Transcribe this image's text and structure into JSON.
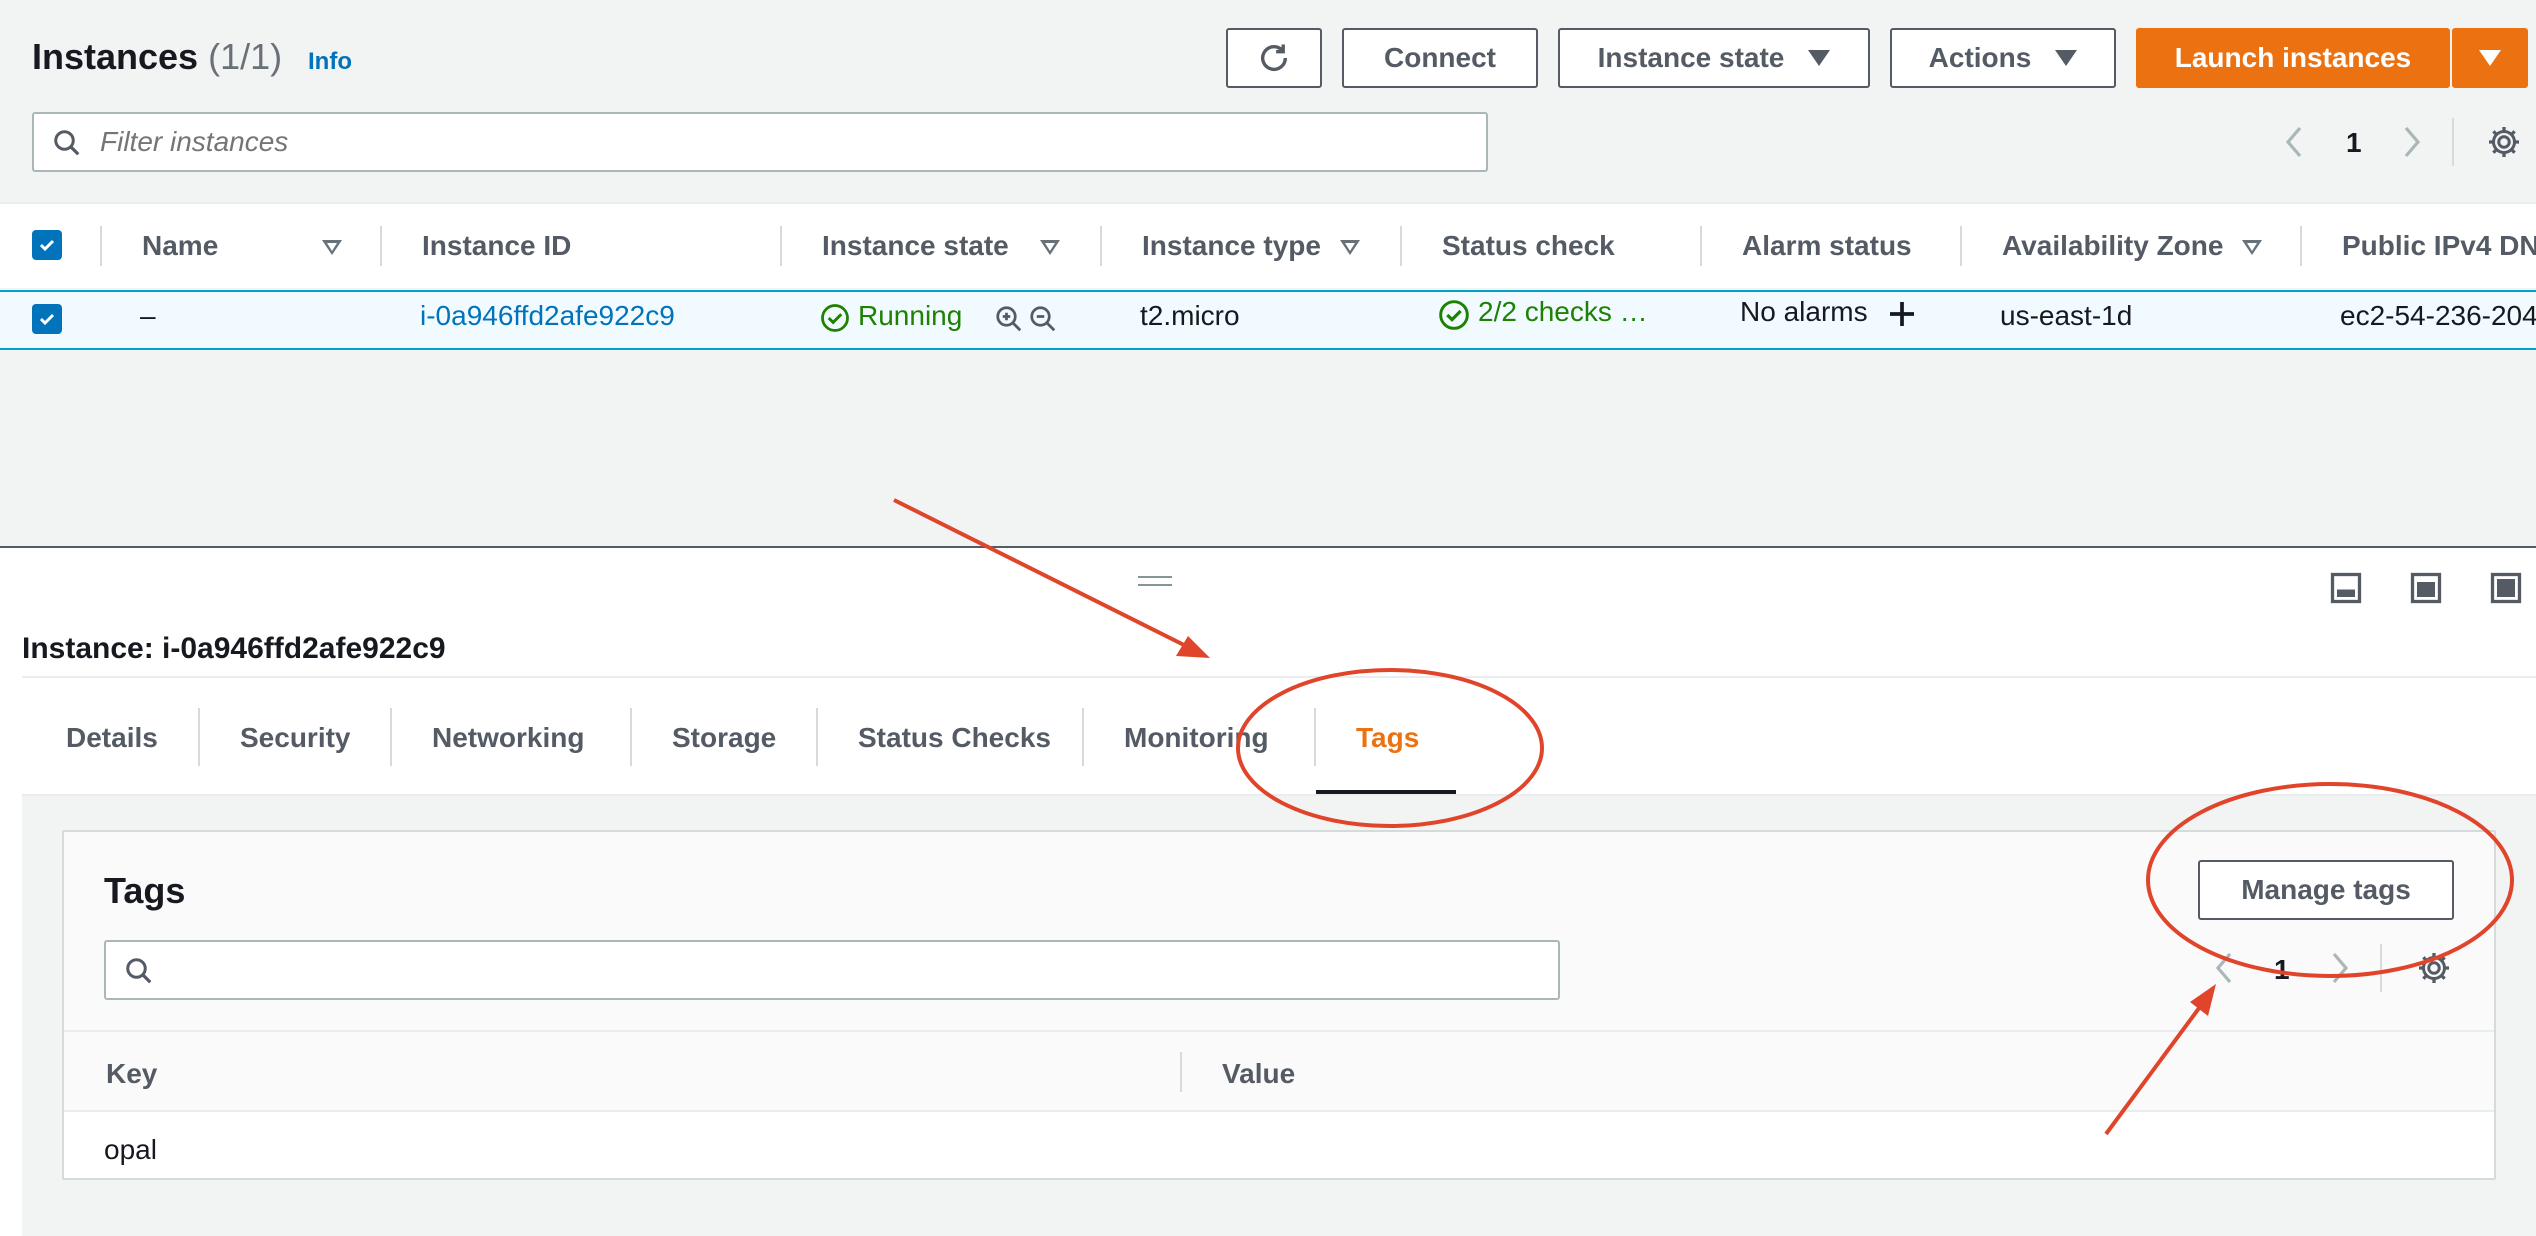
{
  "header": {
    "title": "Instances",
    "count": "(1/1)",
    "info": "Info"
  },
  "toolbar": {
    "connect": "Connect",
    "instance_state": "Instance state",
    "actions": "Actions",
    "launch": "Launch instances"
  },
  "filter": {
    "placeholder": "Filter instances"
  },
  "pagination": {
    "page": "1"
  },
  "table": {
    "columns": [
      "Name",
      "Instance ID",
      "Instance state",
      "Instance type",
      "Status check",
      "Alarm status",
      "Availability Zone",
      "Public IPv4 DN"
    ],
    "row": {
      "name": "–",
      "instance_id": "i-0a946ffd2afe922c9",
      "state": "Running",
      "type": "t2.micro",
      "status_check": "2/2 checks …",
      "alarm": "No alarms",
      "az": "us-east-1d",
      "public_dns": "ec2-54-236-204"
    }
  },
  "details": {
    "title": "Instance: i-0a946ffd2afe922c9",
    "tabs": [
      "Details",
      "Security",
      "Networking",
      "Storage",
      "Status Checks",
      "Monitoring",
      "Tags"
    ],
    "active_tab": "Tags",
    "tags": {
      "title": "Tags",
      "manage": "Manage tags",
      "page": "1",
      "columns": [
        "Key",
        "Value"
      ],
      "rows": [
        {
          "key": "opal",
          "value": ""
        }
      ]
    }
  },
  "colors": {
    "accent": "#ec7211",
    "link": "#0073bb",
    "success": "#1d8102",
    "annotation": "#e0452b"
  }
}
